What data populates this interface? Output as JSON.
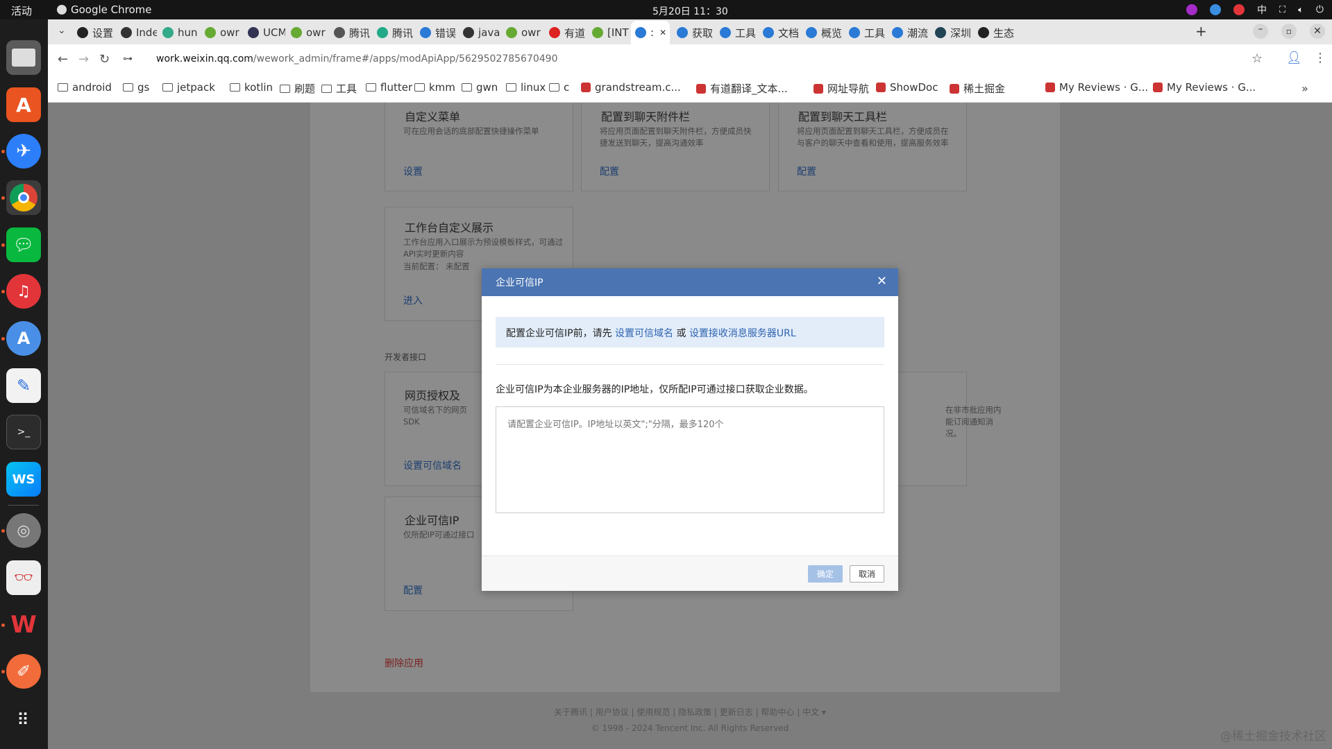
{
  "system": {
    "activities": "活动",
    "app_name": "Google Chrome",
    "clock": "5月20日  11：30",
    "ime": "中"
  },
  "tabs": [
    {
      "label": "设置",
      "color": "#222"
    },
    {
      "label": "Inde",
      "color": "#333"
    },
    {
      "label": "hun",
      "color": "#3a8"
    },
    {
      "label": "owr",
      "color": "#6a3"
    },
    {
      "label": "UCM",
      "color": "#335"
    },
    {
      "label": "owr",
      "color": "#6a3"
    },
    {
      "label": "腾讯",
      "color": "#555"
    },
    {
      "label": "腾讯",
      "color": "#2a8"
    },
    {
      "label": "错误",
      "color": "#2a7ad6"
    },
    {
      "label": "java",
      "color": "#333"
    },
    {
      "label": "owr",
      "color": "#6a3"
    },
    {
      "label": "有道",
      "color": "#d22"
    },
    {
      "label": "[INT",
      "color": "#6a3"
    },
    {
      "label": ":",
      "color": "#2a7ad6"
    },
    {
      "label": "获取",
      "color": "#2a7ad6"
    },
    {
      "label": "工具",
      "color": "#2a7ad6"
    },
    {
      "label": "文档",
      "color": "#2a7ad6"
    },
    {
      "label": "概览",
      "color": "#2a7ad6"
    },
    {
      "label": "工具",
      "color": "#2a7ad6"
    },
    {
      "label": "潮流",
      "color": "#2a7ad6"
    },
    {
      "label": "深圳",
      "color": "#245"
    },
    {
      "label": "生态",
      "color": "#222"
    }
  ],
  "new_tab": "+",
  "url": {
    "host": "work.weixin.qq.com",
    "path": "/wework_admin/frame#/apps/modApiApp/5629502785670490"
  },
  "bookmarks": [
    {
      "label": "android",
      "type": "folder"
    },
    {
      "label": "gs",
      "type": "folder"
    },
    {
      "label": "jetpack",
      "type": "folder"
    },
    {
      "label": "kotlin",
      "type": "folder"
    },
    {
      "label": "刷题",
      "type": "folder"
    },
    {
      "label": "工具",
      "type": "folder"
    },
    {
      "label": "flutter",
      "type": "folder"
    },
    {
      "label": "kmm",
      "type": "folder"
    },
    {
      "label": "gwn",
      "type": "folder"
    },
    {
      "label": "linux",
      "type": "folder"
    },
    {
      "label": "c",
      "type": "folder"
    },
    {
      "label": "grandstream.c...",
      "type": "site"
    },
    {
      "label": "有道翻译_文本...",
      "type": "site"
    },
    {
      "label": "网址导航",
      "type": "site"
    },
    {
      "label": "ShowDoc",
      "type": "site"
    },
    {
      "label": "稀土掘金",
      "type": "site"
    },
    {
      "label": "My Reviews · G...",
      "type": "site"
    },
    {
      "label": "My Reviews · G...",
      "type": "site"
    }
  ],
  "cards": {
    "c1": {
      "title": "自定义菜单",
      "desc": "可在应用会话的底部配置快捷操作菜单",
      "link": "设置"
    },
    "c2": {
      "title": "配置到聊天附件栏",
      "desc": "将应用页面配置到聊天附件栏，方便成员快捷发送到聊天，提高沟通效率",
      "link": "配置"
    },
    "c3": {
      "title": "配置到聊天工具栏",
      "desc": "将应用页面配置到聊天工具栏，方便成员在与客户的聊天中查看和使用，提高服务效率",
      "link": "配置"
    },
    "c4": {
      "title": "工作台自定义展示",
      "desc": "工作台应用入口展示为预设模板样式，可通过API实时更新内容",
      "current": "当前配置： 未配置",
      "link": "进入"
    },
    "c5": {
      "title": "网页授权及",
      "desc": "可信域名下的网页",
      "sdk": "SDK",
      "link": "设置可信域名"
    },
    "c6": {
      "desc1": "在非市批应用内",
      "desc2": "能订阅通知消",
      "desc3": "况。"
    },
    "c7": {
      "title": "企业可信IP",
      "desc": "仅所配IP可通过接口",
      "link": "配置"
    }
  },
  "dev_section": "开发者接口",
  "delete_app": "删除应用",
  "footer": {
    "links": "关于腾讯  |  用户协议  |  使用规范  |  隐私政策  |  更新日志  |  帮助中心  |  中文 ▾",
    "copyright": "© 1998 - 2024 Tencent Inc. All Rights Reserved"
  },
  "watermark": "@稀土掘金技术社区",
  "modal": {
    "title": "企业可信IP",
    "notice_prefix": "配置企业可信IP前，请先 ",
    "notice_link1": "设置可信域名",
    "notice_or": " 或 ",
    "notice_link2": "设置接收消息服务器URL",
    "description": "企业可信IP为本企业服务器的IP地址，仅所配IP可通过接口获取企业数据。",
    "placeholder": "请配置企业可信IP。IP地址以英文\";\"分隔，最多120个",
    "ok": "确定",
    "cancel": "取消"
  }
}
